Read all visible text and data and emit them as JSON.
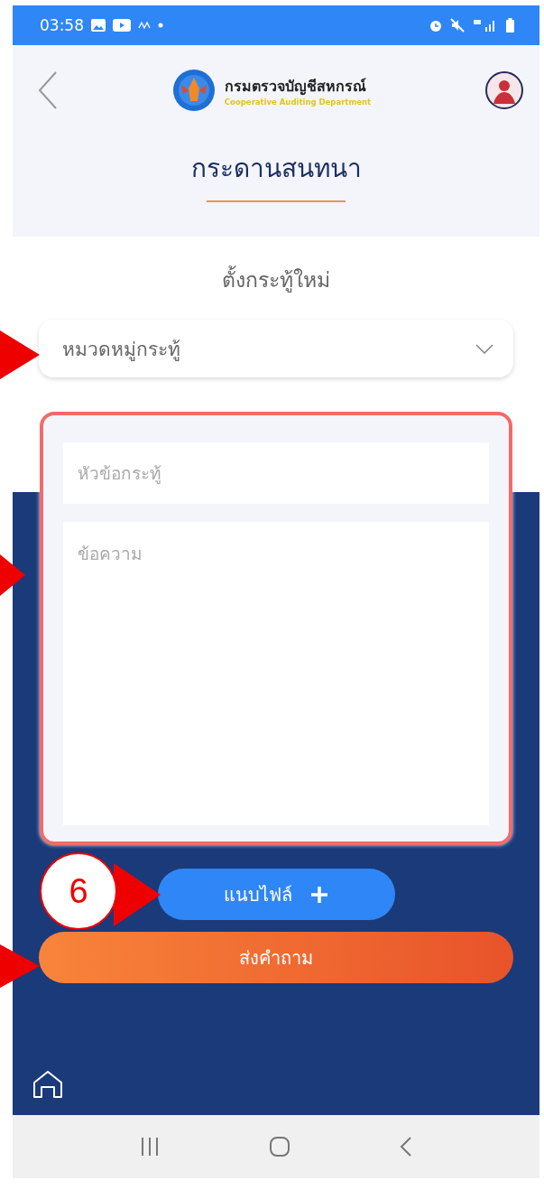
{
  "status_bar": {
    "time": "03:58"
  },
  "header": {
    "logo_title": "กรมตรวจบัญชีสหกรณ์",
    "logo_subtitle": "Cooperative Auditing Department",
    "page_title": "กระดานสนทนา"
  },
  "form": {
    "heading": "ตั้งกระทู้ใหม่",
    "category_select": {
      "placeholder": "หมวดหมู่กระทู้"
    },
    "topic_field": {
      "placeholder": "หัวข้อกระทู้"
    },
    "message_field": {
      "placeholder": "ข้อความ"
    },
    "attach_button": {
      "label": "แนบไฟล์"
    },
    "submit_button": {
      "label": "ส่งคำถาม"
    }
  },
  "annotation": {
    "callout": "6"
  }
}
